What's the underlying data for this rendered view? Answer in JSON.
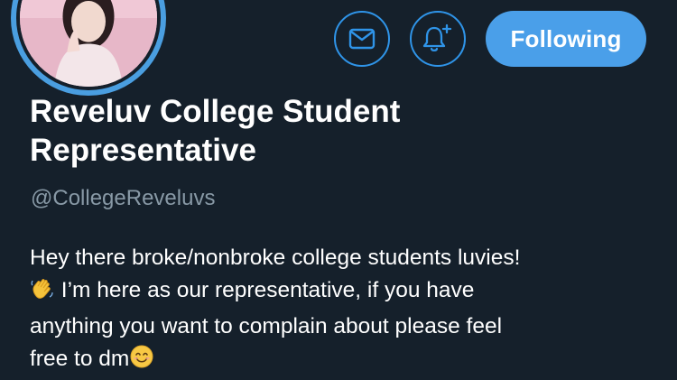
{
  "profile": {
    "display_name": "Reveluv College Student Representative",
    "handle": "@CollegeReveluvs",
    "bio": {
      "line1": "Hey there broke/nonbroke college students luvies!",
      "line2_after_emoji": " I’m here as our representative, if you have",
      "line3": "anything you want to complain about please feel",
      "line4": "free to dm"
    }
  },
  "actions": {
    "following_label": "Following"
  },
  "icons": {
    "mail": "envelope-icon",
    "notifications": "bell-plus-icon",
    "wave": "waving-hand-emoji",
    "smile": "smiling-face-emoji"
  },
  "colors": {
    "background": "#15202b",
    "accent": "#4a9fe9",
    "secondary_text": "#8899a6"
  }
}
